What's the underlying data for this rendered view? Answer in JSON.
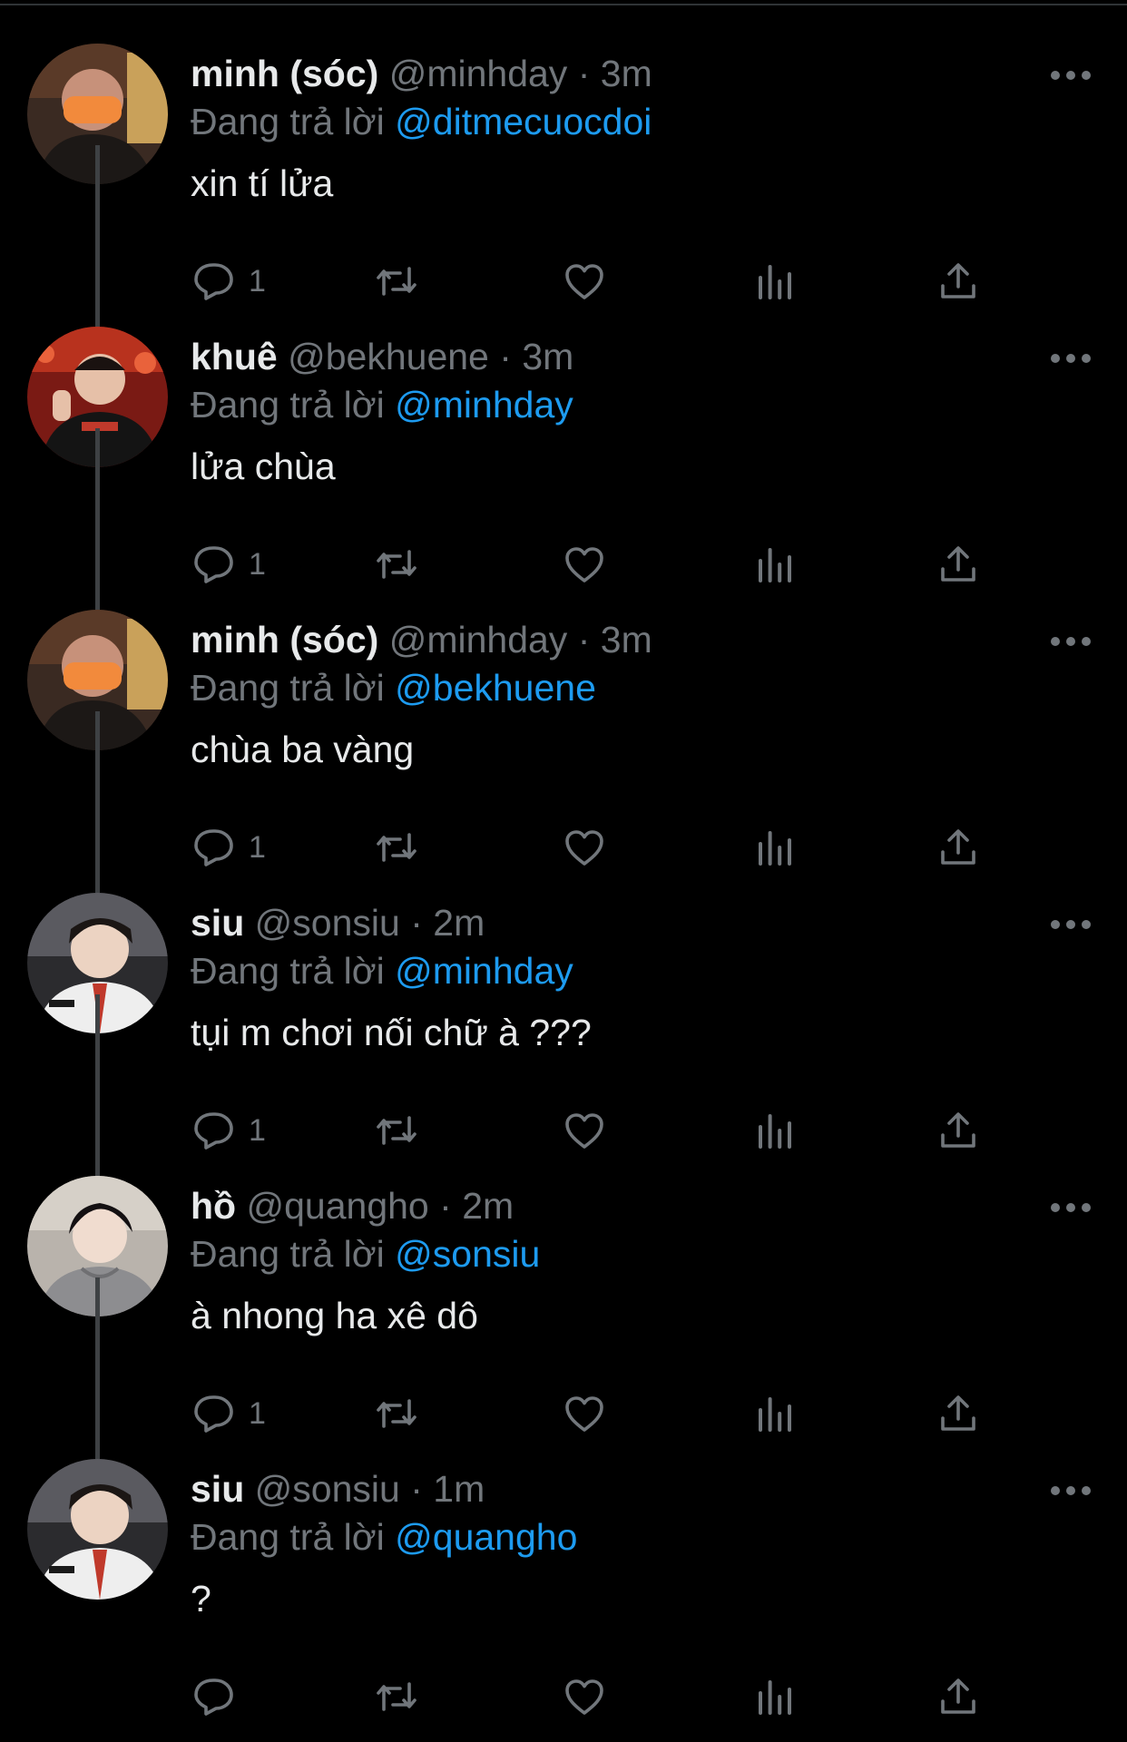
{
  "colors": {
    "background": "#000000",
    "text": "#e7e9ea",
    "secondary": "#71767b",
    "mention": "#1d9bf0",
    "thread_line": "#3e4144"
  },
  "tweets": [
    {
      "name": "minh (sóc)",
      "handle": "@minhday",
      "dot": "·",
      "time": "3m",
      "reply_prefix": "Đang trả lời",
      "reply_to": "@ditmecuocdoi",
      "text": "xin tí lửa",
      "reply_count": "1",
      "avatar": "orange-mask-avatar"
    },
    {
      "name": "khuê",
      "handle": "@bekhuene",
      "dot": "·",
      "time": "3m",
      "reply_prefix": "Đang trả lời",
      "reply_to": "@minhday",
      "text": "lửa chùa",
      "reply_count": "1",
      "avatar": "red-stage-avatar"
    },
    {
      "name": "minh (sóc)",
      "handle": "@minhday",
      "dot": "·",
      "time": "3m",
      "reply_prefix": "Đang trả lời",
      "reply_to": "@bekhuene",
      "text": "chùa ba vàng",
      "reply_count": "1",
      "avatar": "orange-mask-avatar"
    },
    {
      "name": "siu",
      "handle": "@sonsiu",
      "dot": "·",
      "time": "2m",
      "reply_prefix": "Đang trả lời",
      "reply_to": "@minhday",
      "text": "tụi m chơi nối chữ à ???",
      "reply_count": "1",
      "avatar": "white-jacket-avatar"
    },
    {
      "name": "hồ",
      "handle": "@quangho",
      "dot": "·",
      "time": "2m",
      "reply_prefix": "Đang trả lời",
      "reply_to": "@sonsiu",
      "text": "à nhong ha xê dô",
      "reply_count": "1",
      "avatar": "grey-hoodie-avatar"
    },
    {
      "name": "siu",
      "handle": "@sonsiu",
      "dot": "·",
      "time": "1m",
      "reply_prefix": "Đang trả lời",
      "reply_to": "@quangho",
      "text": "?",
      "reply_count": "",
      "avatar": "white-jacket-avatar"
    }
  ]
}
